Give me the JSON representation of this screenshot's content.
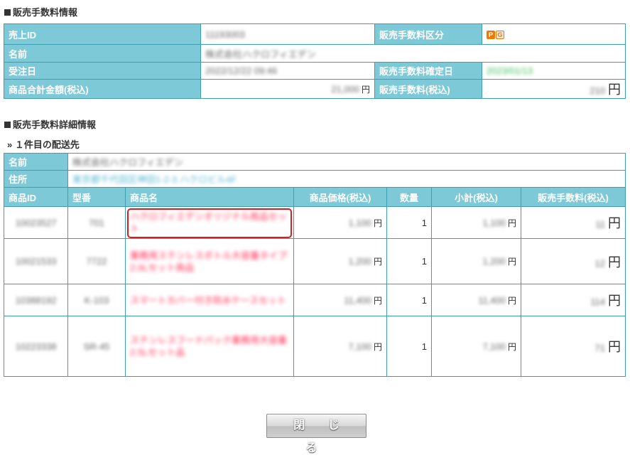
{
  "section1": {
    "title": "販売手数料情報",
    "labels": {
      "sales_id": "売上ID",
      "fee_type": "販売手数料区分",
      "name": "名前",
      "order_date": "受注日",
      "fee_confirm_date": "販売手数料確定日",
      "product_total": "商品合計金額(税込)",
      "fee": "販売手数料(税込)"
    },
    "values": {
      "sales_id": "11193003",
      "name": "株式会社ハクロフィエデン",
      "order_date": "2022/12/22 09:46",
      "fee_confirm_date": "2023/01/13",
      "product_total": "21,000",
      "fee": "210"
    },
    "fee_type_icon": {
      "p": "P",
      "g": "G"
    },
    "yen": "円"
  },
  "section2": {
    "title": "販売手数料詳細情報",
    "subtitle": "» １件目の配送先",
    "labels": {
      "name": "名前",
      "address": "住所"
    },
    "values": {
      "name": "株式会社ハクロフィエデン",
      "address": "東京都千代田区神田1-2-3 ハクロビル4F"
    },
    "columns": [
      "商品ID",
      "型番",
      "商品名",
      "商品価格(税込)",
      "数量",
      "小計(税込)",
      "販売手数料(税込)"
    ],
    "rows": [
      {
        "id": "10023527",
        "model": "701",
        "name": "ハクロフィエデンオリジナル商品セット",
        "price": "1,100",
        "qty": "1",
        "subtotal": "1,100",
        "fee": "11"
      },
      {
        "id": "10021533",
        "model": "7722",
        "name": "業務用ステンレスボトル大容量タイプ2.0Lセット商品",
        "price": "1,200",
        "qty": "1",
        "subtotal": "1,200",
        "fee": "12"
      },
      {
        "id": "10388192",
        "model": "K-103",
        "name": "スマートカバー付き防水ケースセット",
        "price": "11,400",
        "qty": "1",
        "subtotal": "11,400",
        "fee": "114"
      },
      {
        "id": "10223338",
        "model": "SR-45",
        "name": "ステンレスフードパック業務用大容量2.5Lセット品",
        "price": "7,100",
        "qty": "1",
        "subtotal": "7,100",
        "fee": "71"
      }
    ],
    "yen": "円"
  },
  "close_button": "閉 じ る"
}
